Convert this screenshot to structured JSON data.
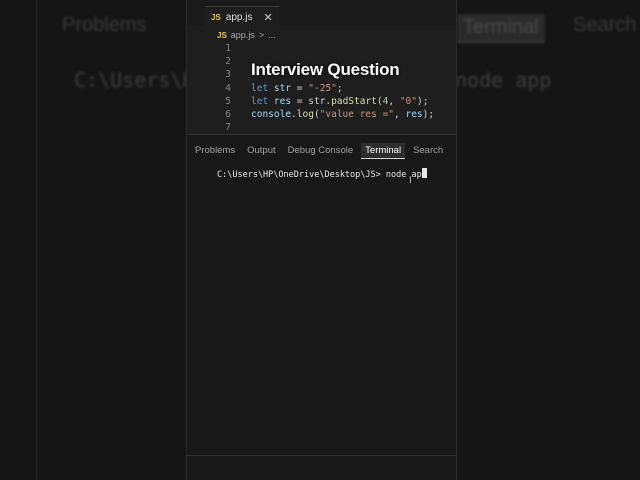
{
  "background": {
    "tabs": [
      "Problems",
      "Terminal",
      "Search"
    ],
    "command": "C:\\Users\\H",
    "command_right": "node app"
  },
  "editor": {
    "file_tab": {
      "badge": "JS",
      "name": "app.js",
      "close": "✕"
    },
    "breadcrumb": {
      "badge": "JS",
      "file": "app.js",
      "sep": ">",
      "rest": "..."
    },
    "overlay_title": "Interview Question",
    "lines": [
      {
        "num": "1"
      },
      {
        "num": "2"
      },
      {
        "num": "3"
      },
      {
        "num": "4",
        "kw": "let",
        "id": "str",
        "op": " = ",
        "str": "\"-25\"",
        "end": ";"
      },
      {
        "num": "5",
        "kw": "let",
        "id": "res",
        "op": " = ",
        "obj": "str.",
        "fn": "padStart",
        "args1": "(",
        "num_arg": "4",
        "comma": ", ",
        "str": "\"0\"",
        "end": ");"
      },
      {
        "num": "6",
        "obj": "console.",
        "fn": "log",
        "args1": "(",
        "str": "\"value res =\"",
        "comma": ", ",
        "id": "res",
        "end": ");"
      },
      {
        "num": "7"
      }
    ]
  },
  "panel": {
    "tabs": [
      "Problems",
      "Output",
      "Debug Console",
      "Terminal",
      "Search"
    ],
    "active_tab": "Terminal",
    "terminal_line": "C:\\Users\\HP\\OneDrive\\Desktop\\JS> node ap"
  },
  "colors": {
    "keyword": "#569cd6",
    "string": "#ce9178",
    "function": "#dcdcaa",
    "variable": "#9cdcfe"
  }
}
